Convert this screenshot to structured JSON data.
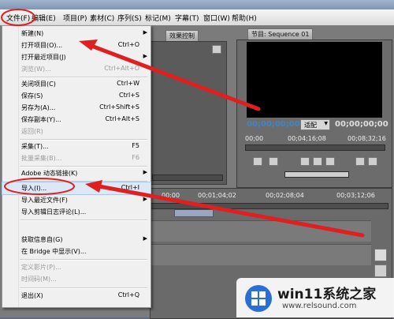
{
  "menubar": {
    "items": [
      "文件(F)",
      "编辑(E)",
      "项目(P)",
      "素材(C)",
      "序列(S)",
      "标记(M)",
      "字幕(T)",
      "窗口(W)",
      "帮助(H)"
    ]
  },
  "file_menu": {
    "items": [
      {
        "label": "新建(N)",
        "shortcut": "",
        "submenu": true,
        "disabled": false
      },
      {
        "label": "打开项目(O)...",
        "shortcut": "Ctrl+O",
        "submenu": false,
        "disabled": false
      },
      {
        "label": "打开最近项目(J)",
        "shortcut": "",
        "submenu": true,
        "disabled": false
      },
      {
        "label": "浏览(W)...",
        "shortcut": "Ctrl+Alt+O",
        "submenu": false,
        "disabled": true
      },
      {
        "label": "关闭项目(C)",
        "shortcut": "Ctrl+W",
        "submenu": false,
        "disabled": false
      },
      {
        "label": "保存(S)",
        "shortcut": "Ctrl+S",
        "submenu": false,
        "disabled": false
      },
      {
        "label": "另存为(A)...",
        "shortcut": "Ctrl+Shift+S",
        "submenu": false,
        "disabled": false
      },
      {
        "label": "保存副本(Y)...",
        "shortcut": "Ctrl+Alt+S",
        "submenu": false,
        "disabled": false
      },
      {
        "label": "返回(R)",
        "shortcut": "",
        "submenu": false,
        "disabled": true
      },
      {
        "label": "采集(T)...",
        "shortcut": "F5",
        "submenu": false,
        "disabled": false
      },
      {
        "label": "批量采集(B)...",
        "shortcut": "F6",
        "submenu": false,
        "disabled": true
      },
      {
        "label": "Adobe 动态链接(K)",
        "shortcut": "",
        "submenu": true,
        "disabled": false
      },
      {
        "label": "导入(I)...",
        "shortcut": "Ctrl+I",
        "submenu": false,
        "disabled": false
      },
      {
        "label": "导入最近文件(F)",
        "shortcut": "",
        "submenu": true,
        "disabled": false
      },
      {
        "label": "导入剪辑日志评论(L)...",
        "shortcut": "",
        "submenu": false,
        "disabled": false
      },
      {
        "label": "获取信息自(G)",
        "shortcut": "",
        "submenu": true,
        "disabled": false
      },
      {
        "label": "在 Bridge 中显示(V)...",
        "shortcut": "",
        "submenu": false,
        "disabled": false
      },
      {
        "label": "定义影片(P)...",
        "shortcut": "",
        "submenu": false,
        "disabled": true
      },
      {
        "label": "时间码(M)...",
        "shortcut": "",
        "submenu": false,
        "disabled": true
      },
      {
        "label": "退出(X)",
        "shortcut": "Ctrl+Q",
        "submenu": false,
        "disabled": false
      }
    ]
  },
  "panels": {
    "effects_tab": "效果控制",
    "program_tab": "节目: Sequence 01",
    "program_timecode": "00;00;00;00",
    "program_fit": "适配",
    "program_duration": "00;00;00;00",
    "program_ruler": [
      "00;00",
      "00;04;16;08",
      "00;08;32;16"
    ],
    "timeline_ruler": [
      "00;00",
      "00;01;04;02",
      "00;02;08;04",
      "00;03;12;06"
    ]
  },
  "watermark": {
    "title": "win11系统之家",
    "url": "www.relsound.com"
  },
  "colors": {
    "annotation_red": "#e02020",
    "timecode_blue": "#3f85c6"
  }
}
